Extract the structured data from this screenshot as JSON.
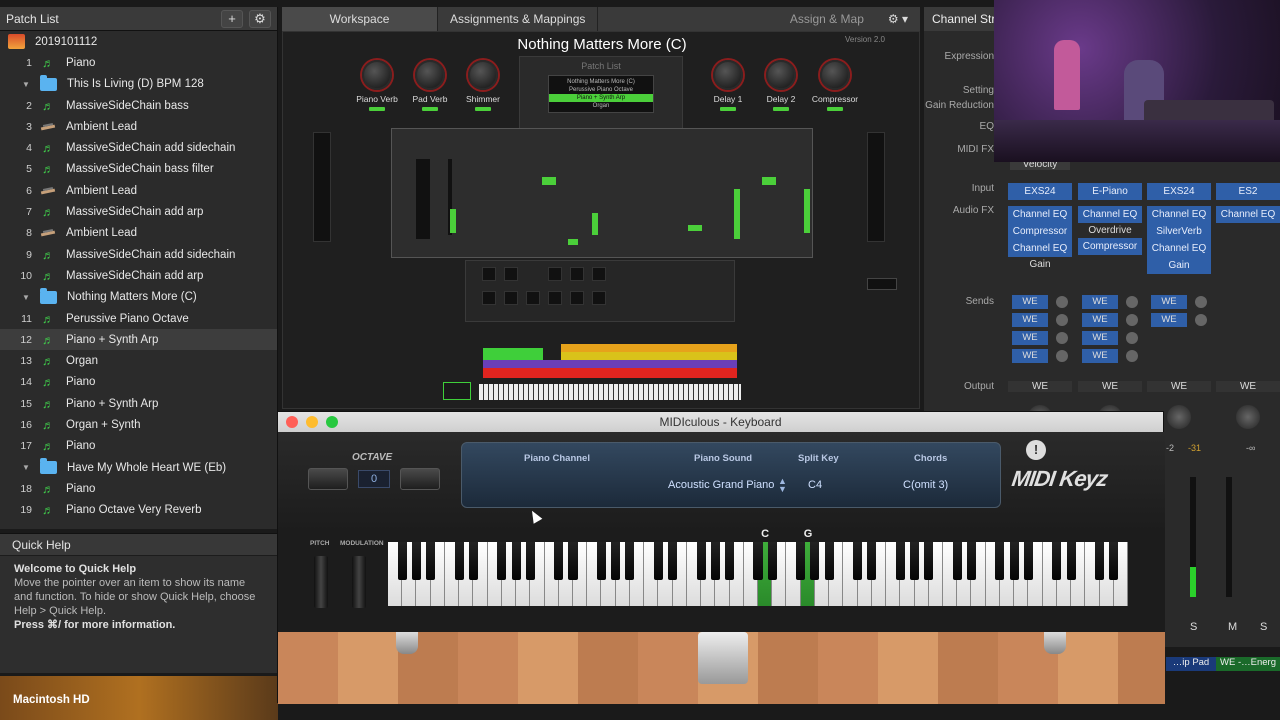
{
  "patch_list": {
    "title": "Patch List",
    "add_label": "+",
    "concert": "2019101112",
    "rows": [
      {
        "num": "1",
        "label": "Piano",
        "kind": "note",
        "indent": 1
      },
      {
        "num": "",
        "label": "This Is Living (D) BPM 128",
        "kind": "folder",
        "indent": 0
      },
      {
        "num": "2",
        "label": "MassiveSideChain bass",
        "kind": "note",
        "indent": 1
      },
      {
        "num": "3",
        "label": "Ambient Lead",
        "kind": "synth",
        "indent": 1
      },
      {
        "num": "4",
        "label": "MassiveSideChain add sidechain",
        "kind": "note",
        "indent": 1
      },
      {
        "num": "5",
        "label": "MassiveSideChain bass filter",
        "kind": "note",
        "indent": 1
      },
      {
        "num": "6",
        "label": "Ambient Lead",
        "kind": "synth",
        "indent": 1
      },
      {
        "num": "7",
        "label": "MassiveSideChain add arp",
        "kind": "note",
        "indent": 1
      },
      {
        "num": "8",
        "label": "Ambient Lead",
        "kind": "synth",
        "indent": 1
      },
      {
        "num": "9",
        "label": "MassiveSideChain add sidechain",
        "kind": "note",
        "indent": 1
      },
      {
        "num": "10",
        "label": "MassiveSideChain add arp",
        "kind": "note",
        "indent": 1
      },
      {
        "num": "",
        "label": "Nothing Matters More (C)",
        "kind": "folder",
        "indent": 0
      },
      {
        "num": "11",
        "label": "Perussive Piano Octave",
        "kind": "note",
        "indent": 1
      },
      {
        "num": "12",
        "label": "Piano + Synth Arp",
        "kind": "note",
        "indent": 1,
        "selected": true
      },
      {
        "num": "13",
        "label": "Organ",
        "kind": "note",
        "indent": 1
      },
      {
        "num": "14",
        "label": "Piano",
        "kind": "note",
        "indent": 1
      },
      {
        "num": "15",
        "label": "Piano + Synth Arp",
        "kind": "note",
        "indent": 1
      },
      {
        "num": "16",
        "label": "Organ  + Synth",
        "kind": "note",
        "indent": 1
      },
      {
        "num": "17",
        "label": "Piano",
        "kind": "note",
        "indent": 1
      },
      {
        "num": "",
        "label": "Have My Whole Heart WE (Eb)",
        "kind": "folder",
        "indent": 0
      },
      {
        "num": "18",
        "label": "Piano",
        "kind": "note",
        "indent": 1
      },
      {
        "num": "19",
        "label": "Piano Octave Very Reverb",
        "kind": "note",
        "indent": 1
      }
    ]
  },
  "quick_help": {
    "title": "Quick Help",
    "heading": "Welcome to Quick Help",
    "body": "Move the pointer over an item to show its name and function. To hide or show Quick Help, choose Help > Quick Help.",
    "footer": "Press ⌘/ for more information."
  },
  "disk_label": "Macintosh HD",
  "workspace": {
    "tabs": [
      "Workspace",
      "Assignments & Mappings"
    ],
    "assign_label": "Assign & Map",
    "title": "Nothing Matters More (C)",
    "version": "Version 2.0",
    "knobs_left": [
      "Piano Verb",
      "Pad Verb",
      "Shimmer"
    ],
    "knobs_right": [
      "Delay 1",
      "Delay 2",
      "Compressor"
    ],
    "mini_patch_list": {
      "title": "Patch List",
      "items": [
        "Nothing Matters More (C)",
        "Perussive Piano Octave",
        "Piano + Synth Arp",
        "Organ"
      ],
      "selected": 2
    }
  },
  "channel_strip": {
    "title": "Channel Strip",
    "labels": {
      "expression": "Expression",
      "setting": "Setting",
      "gain_reduction": "Gain Reduction",
      "eq": "EQ",
      "midi_fx": "MIDI FX",
      "input": "Input",
      "audio_fx": "Audio FX",
      "sends": "Sends",
      "output": "Output"
    },
    "velocity": "Velocity",
    "columns": [
      {
        "input": "EXS24",
        "fx": [
          "Channel EQ",
          "Compressor",
          "Channel EQ",
          "Gain"
        ],
        "fx_blue": [
          true,
          true,
          true,
          false
        ],
        "sends": [
          "WE",
          "WE",
          "WE",
          "WE"
        ],
        "output": "WE"
      },
      {
        "input": "E-Piano",
        "fx": [
          "Channel EQ",
          "Overdrive",
          "Compressor"
        ],
        "fx_blue": [
          true,
          false,
          true
        ],
        "sends": [
          "WE",
          "WE",
          "WE",
          "WE"
        ],
        "output": "WE"
      },
      {
        "input": "EXS24",
        "fx": [
          "Channel EQ",
          "SilverVerb",
          "Channel EQ",
          "Gain"
        ],
        "fx_blue": [
          true,
          true,
          true,
          true
        ],
        "sends": [
          "WE",
          "WE"
        ],
        "output": "WE"
      },
      {
        "input": "ES2",
        "fx": [
          "Channel EQ"
        ],
        "fx_blue": [
          true
        ],
        "sends": [],
        "output": "WE"
      }
    ],
    "meter_values": [
      "-2",
      "-31",
      "-∞"
    ],
    "ms_labels": [
      "M",
      "S",
      "M",
      "S"
    ],
    "bottom_names": [
      "…ip Pad",
      "WE -…Energ"
    ]
  },
  "midi_keyboard": {
    "window_title": "MIDIculous - Keyboard",
    "octave_label": "OCTAVE",
    "octave_value": "0",
    "headers": {
      "piano_channel": "Piano Channel",
      "piano_sound": "Piano Sound",
      "split_key": "Split Key",
      "chords": "Chords"
    },
    "piano_sound": "Acoustic Grand Piano",
    "split_key": "C4",
    "chord": "C(omit 3)",
    "brand": "MIDI Keyz",
    "pitch_label": "PITCH",
    "mod_label": "MODULATION",
    "key_labels": [
      "C",
      "G"
    ]
  },
  "colors": {
    "active_key": "#3fae3b",
    "accent_blue": "#2f5fa8",
    "led_green": "#4bcf3a"
  }
}
